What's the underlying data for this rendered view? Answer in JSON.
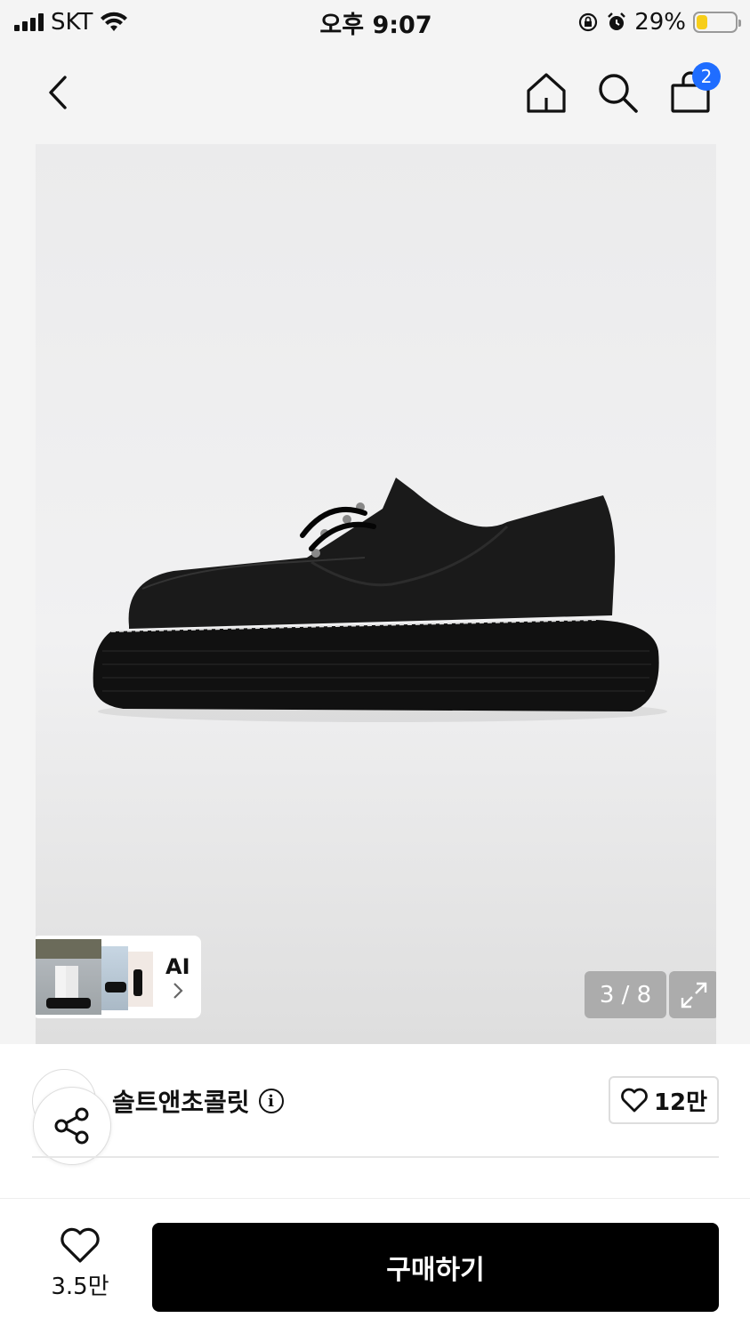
{
  "status_bar": {
    "carrier": "SKT",
    "time": "오후 9:07",
    "battery": "29%"
  },
  "nav": {
    "icons": [
      "back-icon",
      "home-icon",
      "search-icon",
      "cart-icon"
    ],
    "cart_badge": "2"
  },
  "gallery": {
    "counter": "3 / 8",
    "ai_label": "AI"
  },
  "product": {
    "brand": "솔트앤초콜릿",
    "brand_likes": "12만"
  },
  "bottom": {
    "wish_count": "3.5만",
    "buy_label": "구매하기"
  },
  "colors": {
    "badge": "#1f6dff",
    "buy_button": "#000000",
    "battery": "#f7ce1a"
  }
}
